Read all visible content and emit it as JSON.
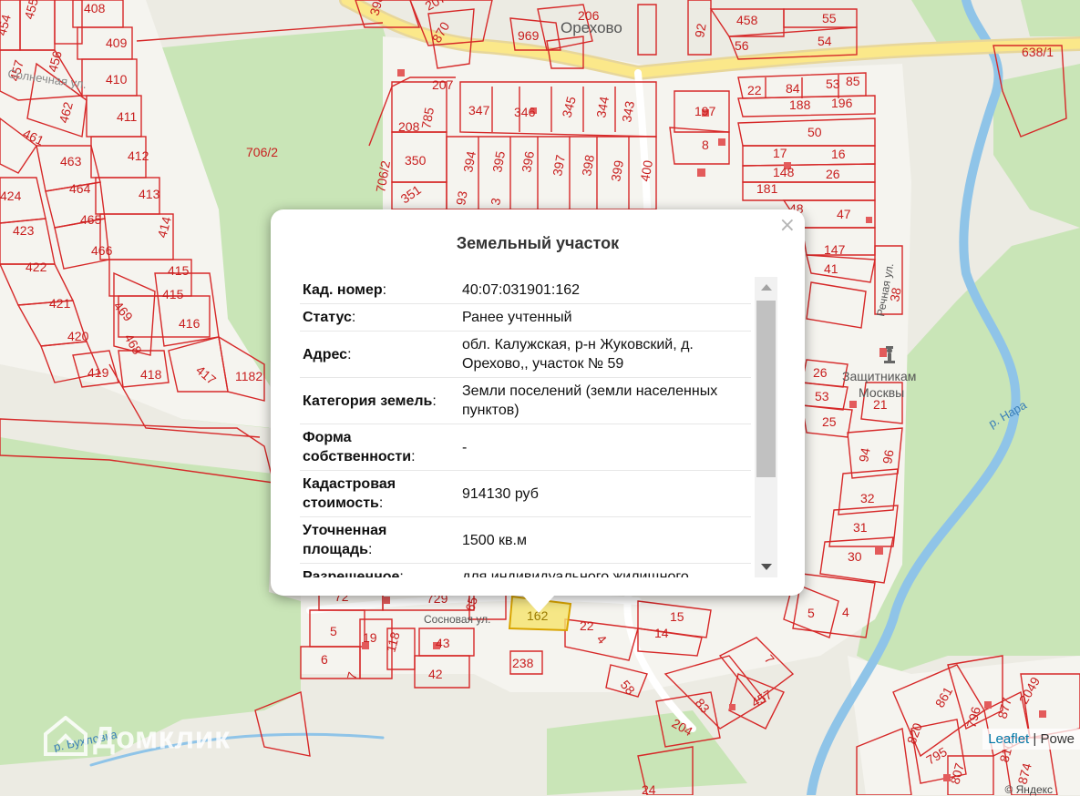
{
  "map": {
    "place_labels": {
      "orekhovo": "Орехово",
      "zashchitnikam_line1": "Защитникам",
      "zashchitnikam_line2": "Москвы",
      "sosnovaya": "Сосновая ул.",
      "rechnaya": "Речная ул.",
      "river_nara": "р. Нара",
      "river_bukhlovka": "р. Бухловка",
      "faded_top_left": "Солнечная ул."
    },
    "parcel_labels": [
      "408",
      "455",
      "454",
      "409",
      "456",
      "457",
      "410",
      "462",
      "411",
      "461",
      "463",
      "412",
      "464",
      "413",
      "424",
      "465",
      "414",
      "423",
      "466",
      "422",
      "415",
      "469",
      "415",
      "421",
      "468",
      "416",
      "420",
      "419",
      "418",
      "417",
      "1182",
      "706/2",
      "706/2",
      "398",
      "2076",
      "870",
      "207",
      "206",
      "969",
      "208",
      "785",
      "347",
      "346",
      "345",
      "344",
      "343",
      "350",
      "394",
      "395",
      "396",
      "397",
      "398",
      "399",
      "400",
      "351",
      "93",
      "3",
      "92",
      "458",
      "55",
      "56",
      "54",
      "638/1",
      "22",
      "84",
      "53",
      "85",
      "188",
      "196",
      "197",
      "8",
      "50",
      "17",
      "16",
      "148",
      "26",
      "181",
      "48",
      "47",
      "147",
      "41",
      "38",
      "26",
      "53",
      "21",
      "25",
      "94",
      "96",
      "32",
      "31",
      "30",
      "4",
      "5",
      "15",
      "14",
      "22",
      "4",
      "7",
      "58",
      "83",
      "457",
      "204",
      "72",
      "729",
      "65",
      "5",
      "19",
      "118",
      "43",
      "6",
      "7",
      "42",
      "238",
      "861",
      "877",
      "2049",
      "796",
      "820",
      "795",
      "810",
      "807",
      "874",
      "24",
      "162"
    ],
    "selected_parcel": "162"
  },
  "popup": {
    "title": "Земельный участок",
    "close_symbol": "×",
    "rows": [
      {
        "key": "Кад. номер",
        "value": "40:07:031901:162"
      },
      {
        "key": "Статус",
        "value": "Ранее учтенный"
      },
      {
        "key": "Адрес",
        "value": "обл. Калужская, р-н Жуковский, д. Орехово,, участок № 59"
      },
      {
        "key": "Категория земель",
        "value": "Земли поселений (земли населенных пунктов)"
      },
      {
        "key": "Форма собственности",
        "value": "-"
      },
      {
        "key": "Кадастровая стоимость",
        "value": "914130 руб"
      },
      {
        "key": "Уточненная площадь",
        "value": "1500 кв.м"
      },
      {
        "key": "Разрешенное",
        "value": "для индивидуального жилищного"
      }
    ]
  },
  "attribution": {
    "leaflet": "Leaflet",
    "separator": " | ",
    "powered": "Powe"
  },
  "watermark": {
    "text": "Домклик",
    "icon": "domclick-logo-icon"
  },
  "copyright": "© Яндекс"
}
